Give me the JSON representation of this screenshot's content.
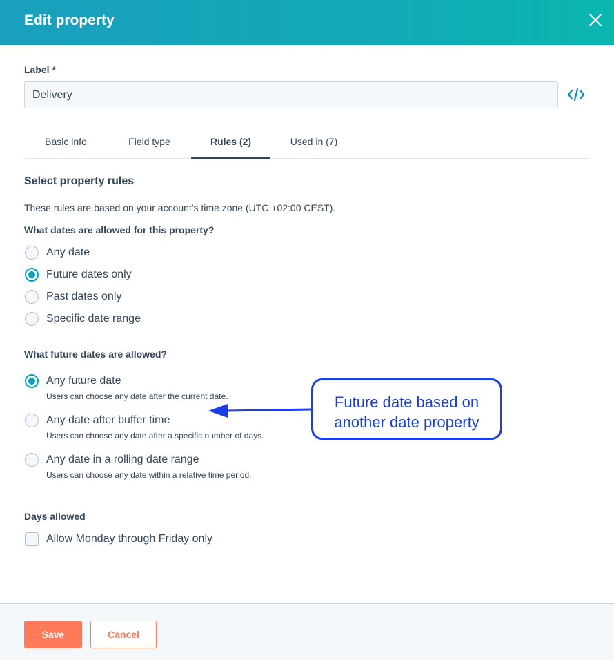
{
  "header": {
    "title": "Edit property"
  },
  "label_field": {
    "label": "Label *",
    "value": "Delivery"
  },
  "tabs": [
    {
      "label": "Basic info",
      "active": false
    },
    {
      "label": "Field type",
      "active": false
    },
    {
      "label": "Rules (2)",
      "active": true
    },
    {
      "label": "Used in (7)",
      "active": false
    }
  ],
  "rules": {
    "title": "Select property rules",
    "timezone_note": "These rules are based on your account's time zone (UTC +02:00 CEST).",
    "dates_question": "What dates are allowed for this property?",
    "date_options": [
      {
        "label": "Any date",
        "checked": false
      },
      {
        "label": "Future dates only",
        "checked": true
      },
      {
        "label": "Past dates only",
        "checked": false
      },
      {
        "label": "Specific date range",
        "checked": false
      }
    ],
    "future_question": "What future dates are allowed?",
    "future_options": [
      {
        "label": "Any future date",
        "help": "Users can choose any date after the current date.",
        "checked": true
      },
      {
        "label": "Any date after buffer time",
        "help": "Users can choose any date after a specific number of days.",
        "checked": false
      },
      {
        "label": "Any date in a rolling date range",
        "help": "Users can choose any date within a relative time period.",
        "checked": false
      }
    ],
    "days_title": "Days allowed",
    "weekdays_only_label": "Allow Monday through Friday only",
    "weekdays_only_checked": false
  },
  "annotation": {
    "line1": "Future date based on",
    "line2": "another date property"
  },
  "footer": {
    "save_label": "Save",
    "cancel_label": "Cancel"
  },
  "colors": {
    "header_start": "#1a9fbd",
    "header_end": "#0ab7b0",
    "accent": "#00a4bd",
    "primary_button": "#ff7a59",
    "annotation": "#1a3ee8",
    "text": "#33475b"
  },
  "icons": {
    "close": "close-icon",
    "code": "code-icon",
    "arrow": "arrow-left-icon"
  }
}
